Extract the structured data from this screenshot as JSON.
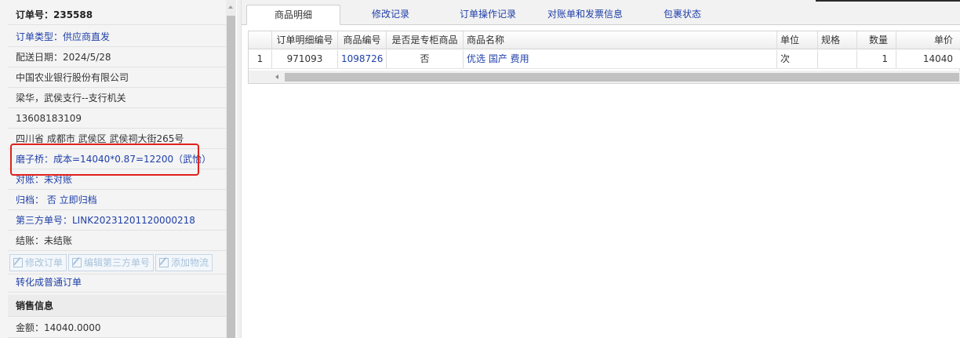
{
  "order": {
    "title": "订单号：235588",
    "type": "订单类型：供应商直发",
    "delivery_date": "配送日期：2024/5/28",
    "company": "中国农业银行股份有限公司",
    "contact": "梁华，武侯支行--支行机关",
    "phone": "13608183109",
    "address": "四川省 成都市 武侯区 武侯祠大街265号",
    "cost_note": "磨子桥：成本=14040*0.87=12200（武怡）",
    "reconcile": "对账：未对账",
    "archive": "归档： 否 立即归档",
    "third_party": "第三方单号：LINK20231201120000218",
    "settle": "结账：未结账",
    "convert_link": "转化成普通订单"
  },
  "buttons": {
    "edit_order": "修改订单",
    "edit_third": "编辑第三方单号",
    "add_logistics": "添加物流"
  },
  "sales": {
    "title": "销售信息",
    "amount": "金额：14040.0000"
  },
  "tabs": [
    {
      "label": "商品明细",
      "active": true
    },
    {
      "label": "修改记录",
      "active": false
    },
    {
      "label": "订单操作记录",
      "active": false
    },
    {
      "label": "对账单和发票信息",
      "active": false
    },
    {
      "label": "包裹状态",
      "active": false
    }
  ],
  "table": {
    "headers": [
      "订单明细编号",
      "商品编号",
      "是否是专柜商品",
      "商品名称",
      "单位",
      "规格",
      "数量",
      "单价"
    ],
    "rows": [
      {
        "index": "1",
        "detail_no": "971093",
        "product_no": "1098726",
        "counter": "否",
        "name": "优选 国产 费用",
        "unit": "次",
        "spec": "",
        "qty": "1",
        "price": "14040"
      }
    ]
  },
  "colors": {
    "link": "#1f3fa8",
    "highlight": "#e0211b"
  }
}
